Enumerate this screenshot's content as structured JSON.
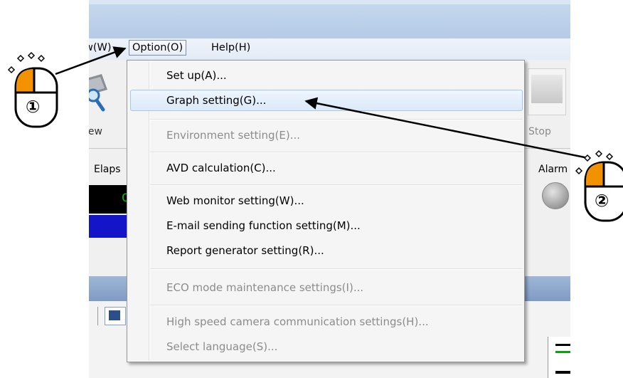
{
  "menubar": {
    "view_label": "w(W)",
    "option_label": "Option(O)",
    "help_label": "Help(H)"
  },
  "toolbar": {
    "view_label": "iew",
    "stop_label": "Stop"
  },
  "panel": {
    "elapsed_label": "Elaps",
    "elapsed_digit": "C",
    "alarm_label": "Alarm"
  },
  "option_menu": {
    "items": [
      {
        "label": "Set up(A)...",
        "enabled": true
      },
      {
        "label": "Graph setting(G)...",
        "enabled": true,
        "highlighted": true
      },
      {
        "label": "Environment setting(E)...",
        "enabled": false
      },
      {
        "label": "AVD calculation(C)...",
        "enabled": true
      },
      {
        "label": "Web monitor setting(W)...",
        "enabled": true
      },
      {
        "label": "E-mail sending function setting(M)...",
        "enabled": true
      },
      {
        "label": "Report generator setting(R)...",
        "enabled": true
      },
      {
        "label": "ECO mode maintenance settings(I)...",
        "enabled": false
      },
      {
        "label": "High speed camera communication settings(H)...",
        "enabled": false
      },
      {
        "label": "Select language(S)...",
        "enabled": false
      }
    ]
  },
  "annotations": {
    "step1_label": "①",
    "step2_label": "②",
    "mouse_highlight_color": "#f39200"
  }
}
